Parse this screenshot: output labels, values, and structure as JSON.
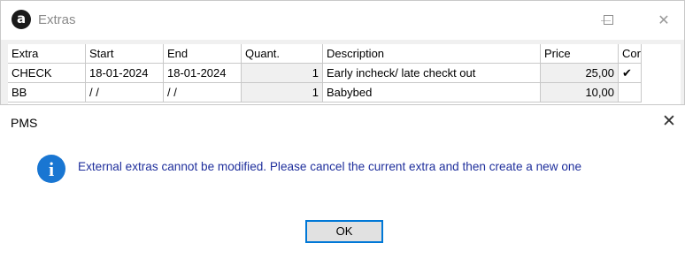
{
  "window": {
    "app_icon_letter": "a",
    "title": "Extras",
    "controls": {
      "close": "✕"
    }
  },
  "grid": {
    "columns": [
      "Extra",
      "Start",
      "End",
      "Quant.",
      "Description",
      "Price",
      "Cor"
    ],
    "rows": [
      {
        "extra": "CHECK",
        "start": "18-01-2024",
        "end": "18-01-2024",
        "quantity": "1",
        "description": "Early incheck/ late checkt out",
        "price": "25,00",
        "confirmed": "✔"
      },
      {
        "extra": "BB",
        "start": "/ /",
        "end": "/ /",
        "quantity": "1",
        "description": "Babybed",
        "price": "10,00",
        "confirmed": ""
      }
    ]
  },
  "dialog": {
    "title": "PMS",
    "close_glyph": "✕",
    "icon": "info-icon",
    "icon_glyph": "i",
    "message": "External extras cannot be modified. Please cancel the current extra and then create a new one",
    "ok_label": "OK"
  },
  "colors": {
    "message_text": "#1f2f9c",
    "info_icon": "#1976d2",
    "button_focus_border": "#0078d7"
  }
}
